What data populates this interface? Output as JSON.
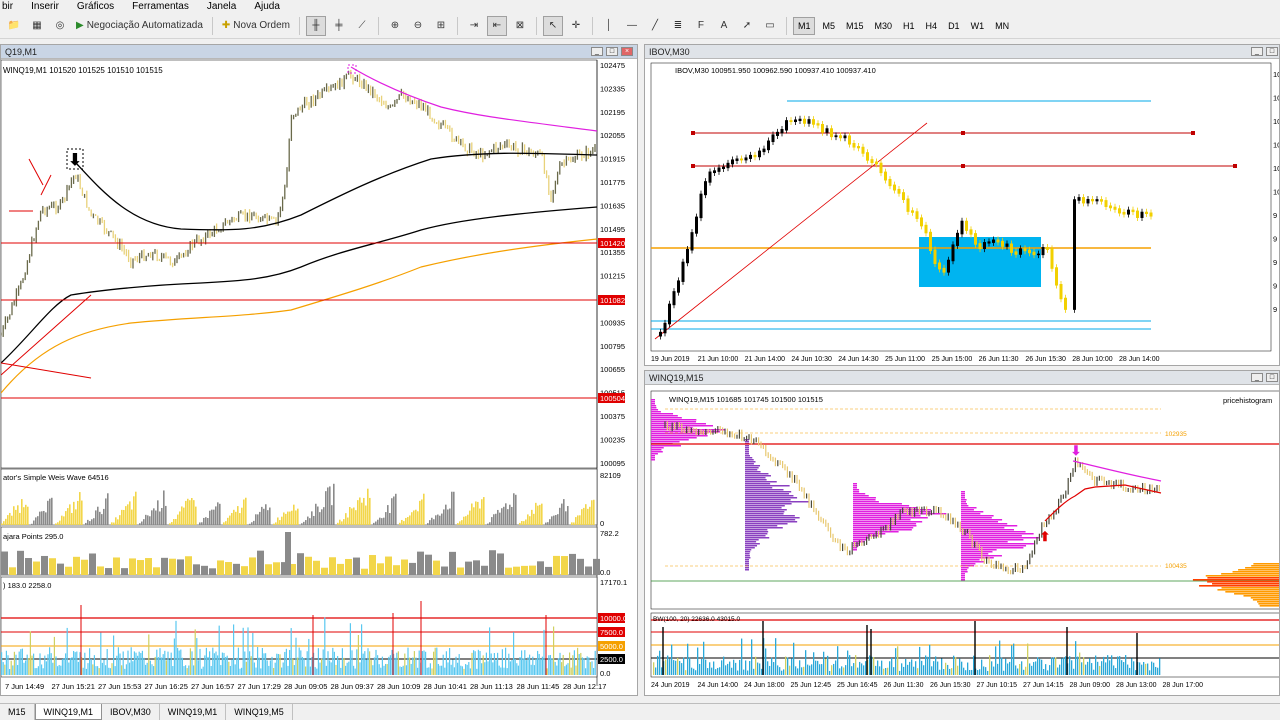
{
  "menu": [
    "bir",
    "Inserir",
    "Gráficos",
    "Ferramentas",
    "Janela",
    "Ajuda"
  ],
  "toolbar": {
    "auto_trading": "Negociação Automatizada",
    "new_order": "Nova Ordem",
    "timeframes": [
      "M1",
      "M5",
      "M15",
      "M30",
      "H1",
      "H4",
      "D1",
      "W1",
      "MN"
    ],
    "active_timeframe": "M1"
  },
  "left_chart": {
    "title": "Q19,M1",
    "header": "WINQ19,M1  101520 101525 101510 101515",
    "price_ticks": [
      "102475",
      "102335",
      "102195",
      "102055",
      "101915",
      "101775",
      "101635",
      "101495",
      "101355",
      "101215",
      "101075",
      "100935",
      "100795",
      "100655",
      "100515",
      "100375",
      "100235",
      "100095"
    ],
    "hlines": [
      "101420",
      "101082",
      "100504"
    ],
    "sub1_label": "ator's Simple Weis Wave  64516",
    "sub1_ticks": [
      "82109",
      "0"
    ],
    "sub2_label": "ajara Points 295.0",
    "sub2_ticks": [
      "782.2",
      "0.0"
    ],
    "sub3_label": ") 183.0 2258.0",
    "sub3_ticks": [
      "17170.1",
      "10000.0",
      "7500.0",
      "5000.0",
      "2500.0",
      "0.0"
    ],
    "time_ticks": [
      "7 Jun 14:49",
      "27 Jun 15:21",
      "27 Jun 15:53",
      "27 Jun 16:25",
      "27 Jun 16:57",
      "27 Jun 17:29",
      "28 Jun 09:05",
      "28 Jun 09:37",
      "28 Jun 10:09",
      "28 Jun 10:41",
      "28 Jun 11:13",
      "28 Jun 11:45",
      "28 Jun 12:17"
    ]
  },
  "ibov_chart": {
    "title": "IBOV,M30",
    "header": "IBOV,M30  100951.950 100962.590 100937.410 100937.410",
    "price_ticks": [
      "10",
      "10",
      "10",
      "10",
      "10",
      "10",
      "9",
      "9",
      "9",
      "9",
      "9"
    ],
    "time_ticks": [
      "19 Jun 2019",
      "21 Jun 10:00",
      "21 Jun 14:00",
      "24 Jun 10:30",
      "24 Jun 14:30",
      "25 Jun 11:00",
      "25 Jun 15:00",
      "26 Jun 11:30",
      "26 Jun 15:30",
      "28 Jun 10:00",
      "28 Jun 14:00"
    ]
  },
  "winq15_chart": {
    "title": "WINQ19,M15",
    "header": "WINQ19,M15  101685 101745 101500 101515",
    "indicator": "pricehistogram",
    "level_high": "102935",
    "level_low": "100435",
    "sub_label": "BW(100, 20) 22636.0 43015.0",
    "time_ticks": [
      "24 Jun 2019",
      "24 Jun 14:00",
      "24 Jun 18:00",
      "25 Jun 12:45",
      "25 Jun 16:45",
      "26 Jun 11:30",
      "26 Jun 15:30",
      "27 Jun 10:15",
      "27 Jun 14:15",
      "28 Jun 09:00",
      "28 Jun 13:00",
      "28 Jun 17:00"
    ]
  },
  "tabs": [
    "M15",
    "WINQ19,M1",
    "IBOV,M30",
    "WINQ19,M1",
    "WINQ19,M5"
  ],
  "active_tab": 1
}
